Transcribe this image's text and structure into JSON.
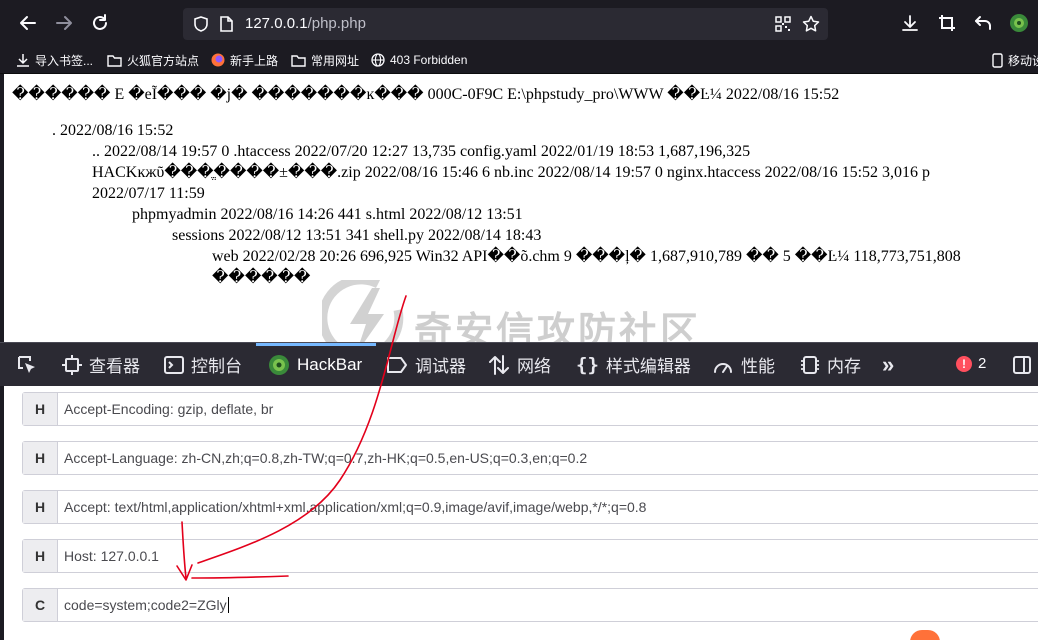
{
  "browser": {
    "url_host": "127.0.0.1",
    "url_path": "/php.php"
  },
  "bookmarks": [
    {
      "label": "导入书签...",
      "icon": "import-icon"
    },
    {
      "label": "火狐官方站点",
      "icon": "folder-icon"
    },
    {
      "label": "新手上路",
      "icon": "firefox-icon"
    },
    {
      "label": "常用网址",
      "icon": "folder-icon"
    },
    {
      "label": "403 Forbidden",
      "icon": "globe-icon"
    },
    {
      "label": "移动设",
      "icon": "mobile-icon"
    }
  ],
  "page": {
    "lines": [
      "������ E �eĨ��� �j� �������ĸ��� 000C-0F9C E:\\phpstudy_pro\\WWW ��Ŀ¼ 2022/08/16 15:52",
      ". 2022/08/16 15:52",
      ".. 2022/08/14 19:57 0 .htaccess 2022/07/20 12:27 13,735 config.yaml 2022/01/19 18:53 1,687,196,325",
      "HACKĸжῦ���ֱ����±���.zip 2022/08/16 15:46 6 nb.inc 2022/08/14 19:57 0 nginx.htaccess 2022/08/16 15:52 3,016 p",
      "2022/07/17 11:59",
      "phpmyadmin 2022/08/16 14:26 441 s.html 2022/08/12 13:51",
      "sessions 2022/08/12 13:51 341 shell.py 2022/08/14 18:43",
      "web 2022/02/28 20:26 696,925 Win32 API��õ.chm 9 ���ļ� 1,687,910,789 �� 5 ��Ŀ¼ 118,773,751,808",
      "������"
    ],
    "watermark": "奇安信攻防社区"
  },
  "devtools": {
    "tabs": [
      {
        "label": "",
        "icon": "element-picker-icon"
      },
      {
        "label": "查看器",
        "icon": "inspector-icon"
      },
      {
        "label": "控制台",
        "icon": "console-icon"
      },
      {
        "label": "HackBar",
        "icon": "hackbar-icon"
      },
      {
        "label": "调试器",
        "icon": "debugger-icon"
      },
      {
        "label": "网络",
        "icon": "network-icon"
      },
      {
        "label": "样式编辑器",
        "icon": "style-editor-icon"
      },
      {
        "label": "性能",
        "icon": "performance-icon"
      },
      {
        "label": "内存",
        "icon": "memory-icon"
      }
    ],
    "active_tab": "HackBar",
    "error_count": "2"
  },
  "hackbar": {
    "rows": [
      {
        "type": "H",
        "value": "Accept-Encoding: gzip, deflate, br"
      },
      {
        "type": "H",
        "value": "Accept-Language: zh-CN,zh;q=0.8,zh-TW;q=0.7,zh-HK;q=0.5,en-US;q=0.3,en;q=0.2"
      },
      {
        "type": "H",
        "value": "Accept: text/html,application/xhtml+xml,application/xml;q=0.9,image/avif,image/webp,*/*;q=0.8"
      },
      {
        "type": "H",
        "value": "Host: 127.0.0.1"
      },
      {
        "type": "C",
        "value": "code=system;code2=ZGly"
      }
    ]
  },
  "colors": {
    "chrome": "#1c1b22",
    "urlbar": "#2b2a33",
    "devtools": "#2b2a33",
    "accent": "#75b8ff",
    "annotation": "#e3001b"
  }
}
